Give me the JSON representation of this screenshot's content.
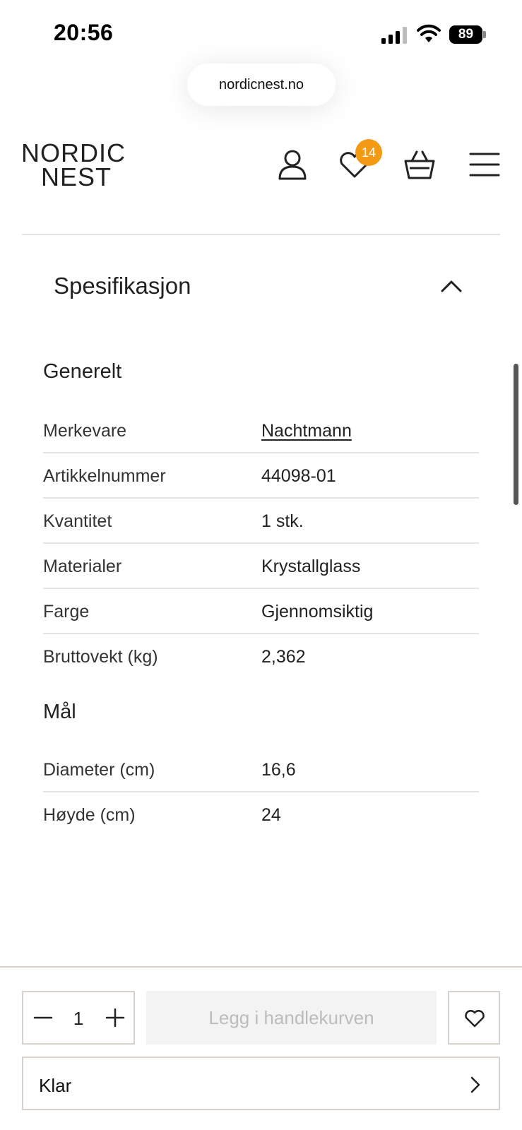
{
  "status_bar": {
    "time": "20:56",
    "battery": "89"
  },
  "browser": {
    "url": "nordicnest.no"
  },
  "header": {
    "logo_line1": "NORDIC",
    "logo_line2": "NEST",
    "wishlist_count": "14"
  },
  "accordion": {
    "title": "Spesifikasjon"
  },
  "general": {
    "title": "Generelt",
    "rows": [
      {
        "label": "Merkevare",
        "value": "Nachtmann"
      },
      {
        "label": "Artikkelnummer",
        "value": "44098-01"
      },
      {
        "label": "Kvantitet",
        "value": "1 stk."
      },
      {
        "label": "Materialer",
        "value": "Krystallglass"
      },
      {
        "label": "Farge",
        "value": "Gjennomsiktig"
      },
      {
        "label": "Bruttovekt (kg)",
        "value": "2,362"
      }
    ]
  },
  "dimensions": {
    "title": "Mål",
    "rows": [
      {
        "label": "Diameter (cm)",
        "value": "16,6"
      },
      {
        "label": "Høyde (cm)",
        "value": "24"
      }
    ]
  },
  "purchase_bar": {
    "quantity": "1",
    "add_to_cart_label": "Legg i handlekurven",
    "klarna_label": "Klar"
  }
}
